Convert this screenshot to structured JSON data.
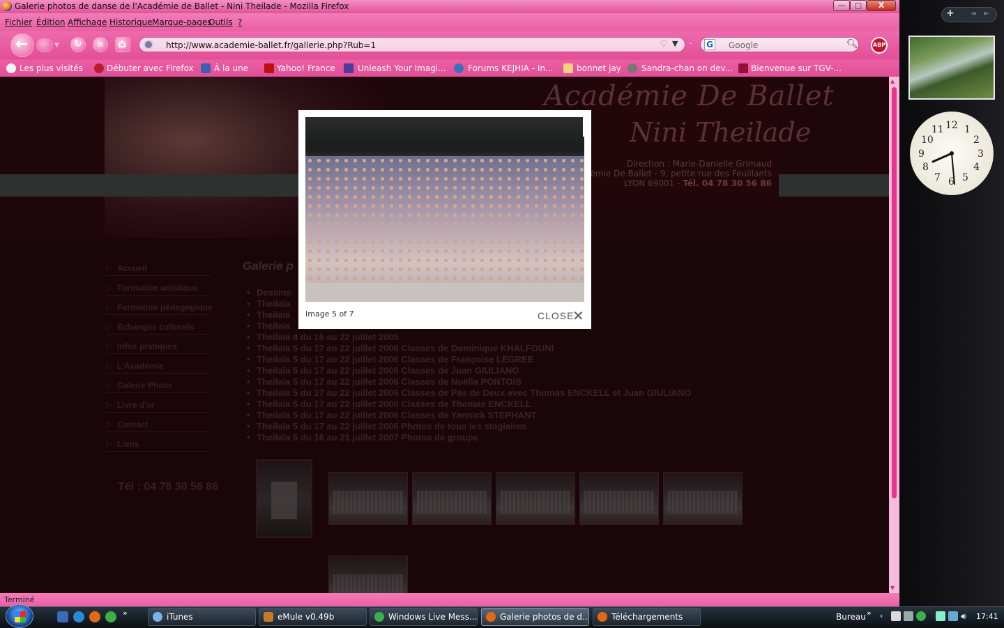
{
  "window": {
    "title": "Galerie photos de danse de l'Académie de Ballet - Nini Theilade - Mozilla Firefox",
    "min_label": "—",
    "max_label": "□",
    "close_label": "X"
  },
  "menu": [
    "Fichier",
    "Édition",
    "Affichage",
    "Historique",
    "Marque-pages",
    "Outils",
    "?"
  ],
  "toolbar": {
    "url": "http://www.academie-ballet.fr/gallerie.php?Rub=1",
    "search_placeholder": "Google",
    "search_engine_glyph": "G",
    "abp_label": "ABP"
  },
  "bookmarks": [
    "Les plus visités",
    "Débuter avec Firefox",
    "À la une",
    "Yahoo! France",
    "Unleash Your Imagi...",
    "Forums KEJHIA - In...",
    "bonnet jay",
    "Sandra-chan on dev...",
    "Bienvenue sur TGV-..."
  ],
  "site": {
    "logo_line1": "Académie De Ballet",
    "logo_line2": "Nini Theilade",
    "address_line1": "Direction : Marie-Danielle Grimaud",
    "address_line2": "Académie De Ballet - 9, petite rue des Feuillants",
    "address_line3_prefix": "LYON 69001 - ",
    "address_line3_tel": "Tél. 04 78 30 56 86",
    "nav": [
      "Accueil",
      "Formation artistique",
      "Formation pédagogique",
      "Echanges culturels",
      "Infos pratiques",
      "L'Académie",
      "Galerie Photo",
      "Livre d'or",
      "Contact",
      "Liens"
    ],
    "tel": "Tél : 04 78 30 56 86",
    "gallery_title": "Galerie p",
    "gallery_items": [
      "Dessins",
      "Theilaïa",
      "Theilaïa",
      "Theilaïa",
      "Theilaïa 4 du 16 au 22 juillet 2005",
      "Theilaïa 5 du 17 au 22 juillet 2006 Classes de Dominique KHALFOUNI",
      "Theilaïa 5 du 17 au 22 juillet 2006 Classes de Françoise LEGREE",
      "Theilaïa 5 du 17 au 22 juillet 2006 Classes de Juan GIULIANO",
      "Theilaïa 5 du 17 au 22 juillet 2006 Classes de Noëlla PONTOIS",
      "Theilaïa 5 du 17 au 22 juillet 2006 Classes de Pas de Deux avec Thomas ENCKELL et Juan GIULIANO",
      "Theilaïa 5 du 17 au 22 juillet 2006 Classes de Thomas ENCKELL",
      "Theilaïa 5 du 17 au 22 juillet 2006 Classes de Yannick STEPHANT",
      "Theilaïa 5 du 17 au 22 juillet 2006 Photos de tous les stagiaires",
      "Theilaïa 6 du 16 au 21 juillet 2007 Photos de groupe"
    ]
  },
  "lightbox": {
    "caption": "Image 5 of 7",
    "close_label": "CLOSE",
    "close_glyph": "✕"
  },
  "status": "Terminé",
  "gadgets": {
    "add_glyph": "+",
    "prev_glyph": "◄",
    "next_glyph": "►",
    "clock_numbers": [
      "12",
      "1",
      "2",
      "3",
      "4",
      "5",
      "6",
      "7",
      "8",
      "9",
      "10",
      "11"
    ]
  },
  "taskbar": {
    "tasks": [
      {
        "label": "iTunes",
        "active": false
      },
      {
        "label": "eMule v0.49b",
        "active": false
      },
      {
        "label": "Windows Live Mess...",
        "active": false
      },
      {
        "label": "Galerie photos de d...",
        "active": true
      },
      {
        "label": "Téléchargements",
        "active": false
      }
    ],
    "toolbar_label": "Bureau",
    "more_glyph": "»",
    "clock": "17:41"
  },
  "colors": {
    "firefox_pink": "#e8559a",
    "page_bg": "#1a0509",
    "nav_text": "#3c1e22"
  }
}
